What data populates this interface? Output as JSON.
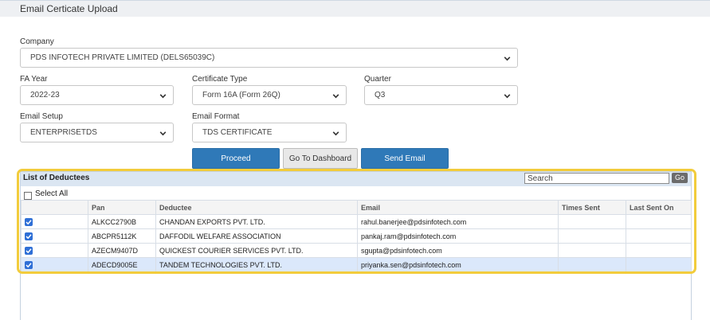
{
  "header": {
    "title": "Email Certicate Upload"
  },
  "company": {
    "label": "Company",
    "value": "PDS INFOTECH PRIVATE LIMITED (DELS65039C)"
  },
  "fa_year": {
    "label": "FA Year",
    "value": "2022-23"
  },
  "certificate_type": {
    "label": "Certificate Type",
    "value": "Form 16A (Form 26Q)"
  },
  "quarter": {
    "label": "Quarter",
    "value": "Q3"
  },
  "email_setup": {
    "label": "Email Setup",
    "value": "ENTERPRISETDS"
  },
  "email_format": {
    "label": "Email Format",
    "value": "TDS CERTIFICATE"
  },
  "buttons": {
    "proceed": "Proceed",
    "dashboard": "Go To Dashboard",
    "send_email": "Send Email"
  },
  "grid": {
    "title": "List of Deductees",
    "search_placeholder": "Search",
    "go_label": "Go",
    "select_all": "Select All",
    "columns": {
      "pan": "Pan",
      "deductee": "Deductee",
      "email": "Email",
      "times_sent": "Times Sent",
      "last_sent": "Last Sent On"
    },
    "rows": [
      {
        "checked": true,
        "pan": "ALKCC2790B",
        "deductee": "CHANDAN EXPORTS PVT. LTD.",
        "email": "rahul.banerjee@pdsinfotech.com",
        "times_sent": "",
        "last_sent": ""
      },
      {
        "checked": true,
        "pan": "ABCPR5112K",
        "deductee": "DAFFODIL WELFARE ASSOCIATION",
        "email": "pankaj.ram@pdsinfotech.com",
        "times_sent": "",
        "last_sent": ""
      },
      {
        "checked": true,
        "pan": "AZECM9407D",
        "deductee": "QUICKEST COURIER SERVICES PVT. LTD.",
        "email": "sgupta@pdsinfotech.com",
        "times_sent": "",
        "last_sent": ""
      },
      {
        "checked": true,
        "pan": "ADECD9005E",
        "deductee": "TANDEM TECHNOLOGIES PVT. LTD.",
        "email": "priyanka.sen@pdsinfotech.com",
        "times_sent": "",
        "last_sent": ""
      }
    ]
  },
  "colors": {
    "primary_button": "#2f79b8",
    "highlight_outline": "#f2cc3c",
    "selected_row": "#dbe8fb",
    "checkbox": "#2f6fd6"
  }
}
